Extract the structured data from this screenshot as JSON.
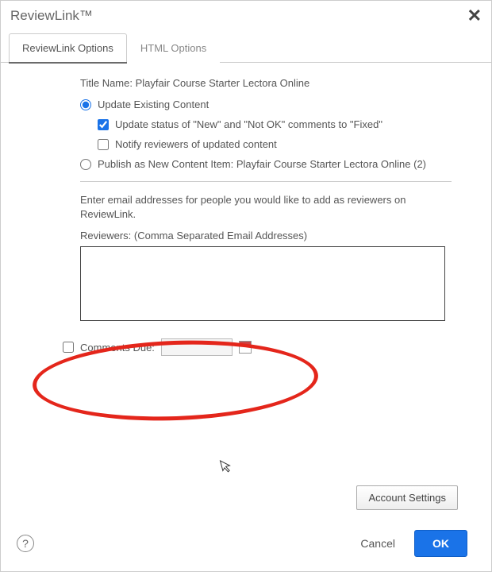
{
  "dialog": {
    "title": "ReviewLink™"
  },
  "tabs": {
    "reviewlink": "ReviewLink Options",
    "html": "HTML Options"
  },
  "form": {
    "title_name_label": "Title Name:",
    "title_name_value": "Playfair Course Starter Lectora Online",
    "update_existing": "Update Existing Content",
    "update_status": "Update status of \"New\" and \"Not OK\" comments to \"Fixed\"",
    "notify_reviewers": "Notify reviewers of updated content",
    "publish_new": "Publish as New Content Item: Playfair Course Starter Lectora Online (2)",
    "email_instructions": "Enter email addresses for people you would like to add as reviewers on ReviewLink.",
    "reviewers_label": "Reviewers: (Comma Separated Email Addresses)",
    "comments_due_label": "Comments Due:"
  },
  "buttons": {
    "account_settings": "Account Settings",
    "cancel": "Cancel",
    "ok": "OK"
  }
}
